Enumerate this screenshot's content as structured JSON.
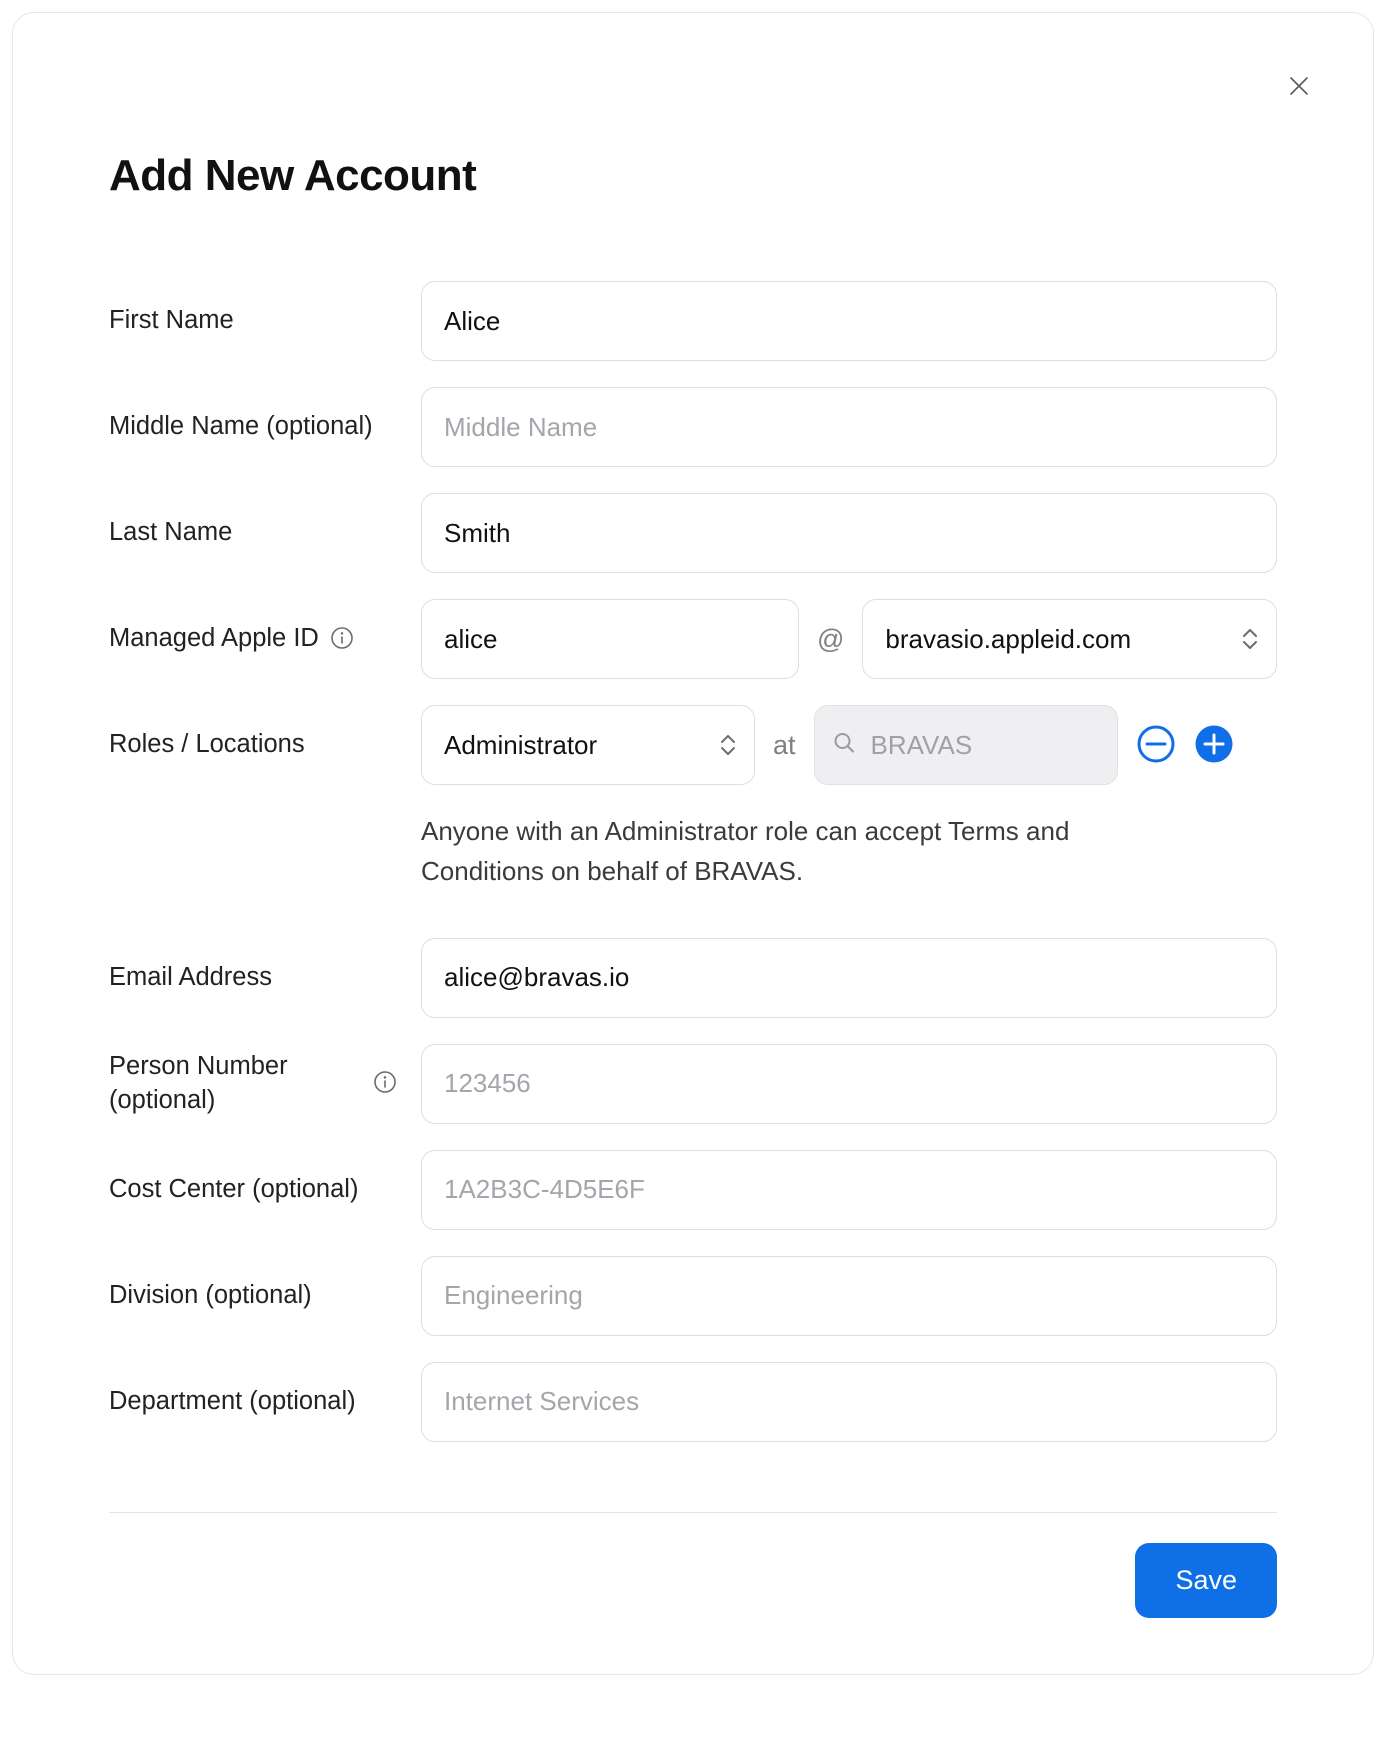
{
  "title": "Add New Account",
  "close_icon": "close",
  "fields": {
    "first_name": {
      "label": "First Name",
      "value": "Alice",
      "placeholder": ""
    },
    "middle_name": {
      "label": "Middle Name (optional)",
      "value": "",
      "placeholder": "Middle Name"
    },
    "last_name": {
      "label": "Last Name",
      "value": "Smith",
      "placeholder": ""
    },
    "apple_id": {
      "label": "Managed Apple ID",
      "local": "alice",
      "at": "@",
      "domain": "bravasio.appleid.com"
    },
    "roles": {
      "label": "Roles / Locations",
      "role": "Administrator",
      "at_word": "at",
      "location_placeholder": "BRAVAS"
    },
    "roles_helper": "Anyone with an Administrator role can accept Terms and Conditions on behalf of BRAVAS.",
    "email": {
      "label": "Email Address",
      "value": "alice@bravas.io",
      "placeholder": ""
    },
    "person_num": {
      "label": "Person Number (optional)",
      "value": "",
      "placeholder": "123456"
    },
    "cost_center": {
      "label": "Cost Center (optional)",
      "value": "",
      "placeholder": "1A2B3C-4D5E6F"
    },
    "division": {
      "label": "Division (optional)",
      "value": "",
      "placeholder": "Engineering"
    },
    "department": {
      "label": "Department (optional)",
      "value": "",
      "placeholder": "Internet Services"
    }
  },
  "footer": {
    "save_label": "Save"
  }
}
